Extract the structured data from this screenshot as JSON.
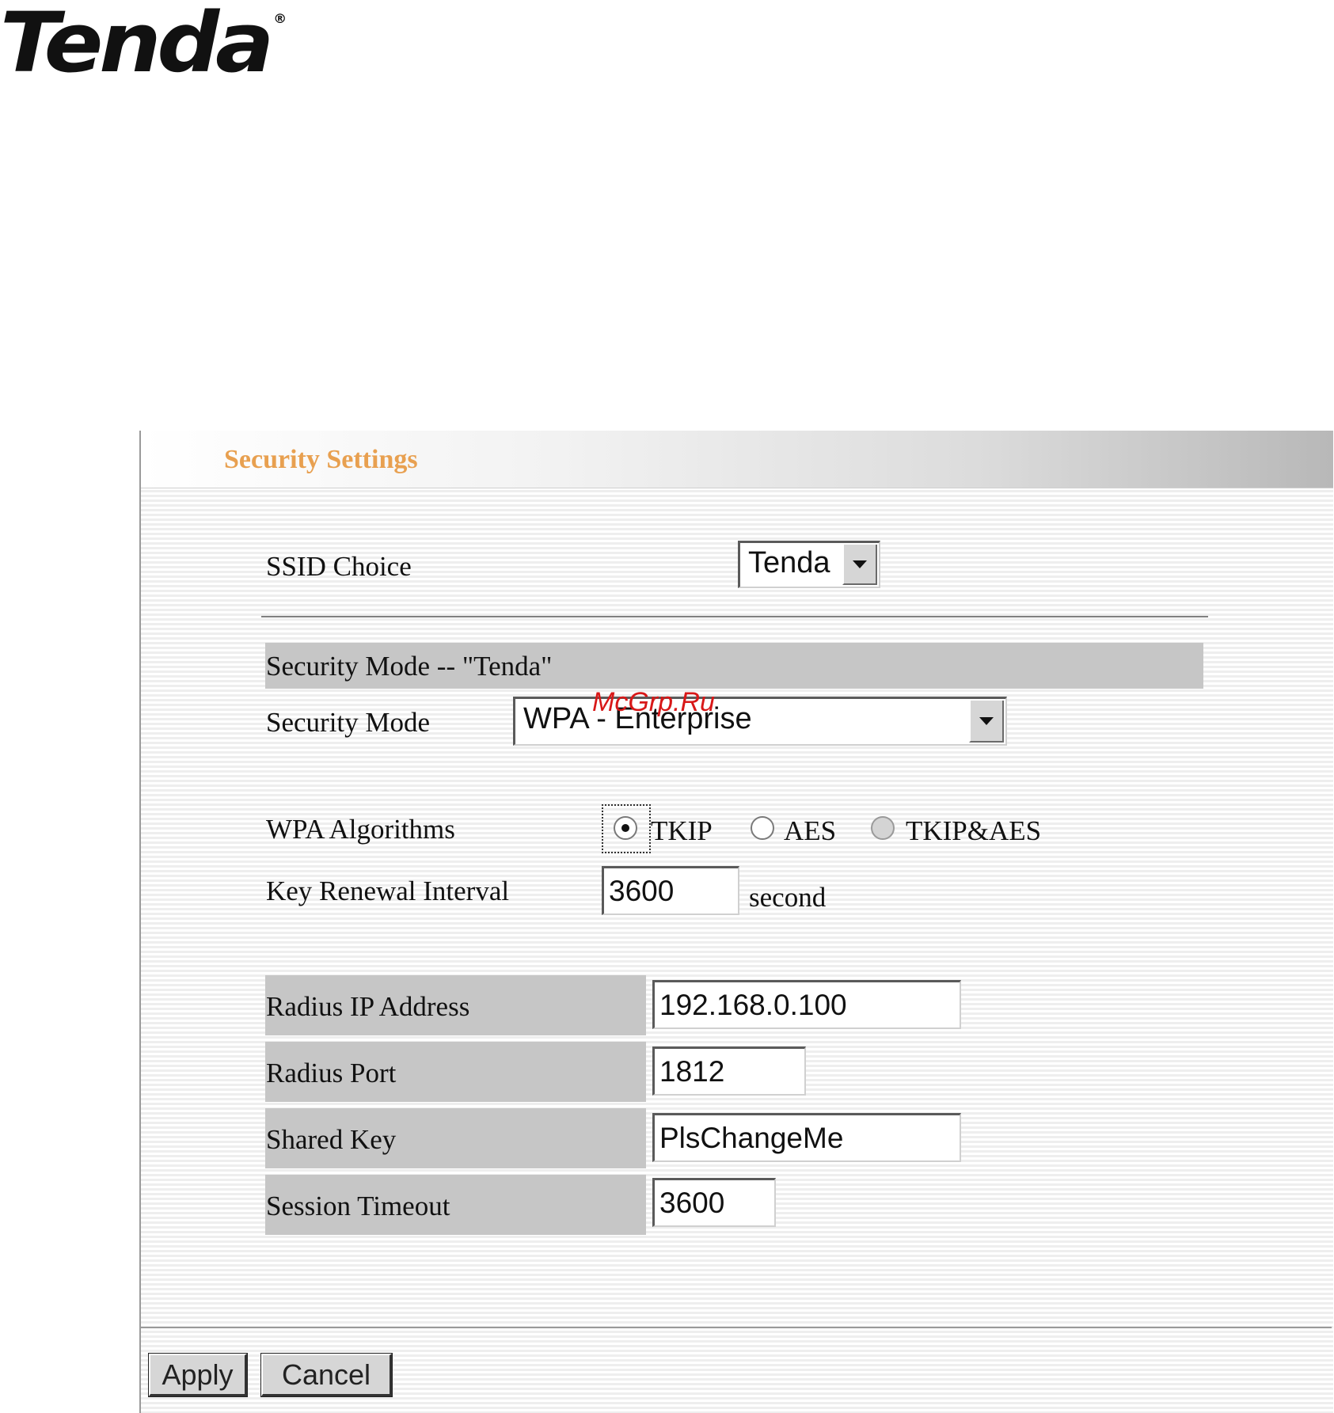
{
  "brand": {
    "logo_text": "Tenda",
    "registered_mark": "®"
  },
  "panel": {
    "title": "Security Settings"
  },
  "ssid": {
    "label": "SSID Choice",
    "selected": "Tenda"
  },
  "security_mode": {
    "section_title": "Security Mode -- \"Tenda\"",
    "label": "Security Mode",
    "selected": "WPA - Enterprise"
  },
  "wpa_algorithms": {
    "label": "WPA Algorithms",
    "options": [
      {
        "label": "TKIP",
        "checked": true
      },
      {
        "label": "AES",
        "checked": false
      },
      {
        "label": "TKIP&AES",
        "checked": false,
        "disabled": true
      }
    ]
  },
  "key_renewal": {
    "label": "Key Renewal Interval",
    "value": "3600",
    "unit": "second"
  },
  "radius": {
    "ip_label": "Radius IP Address",
    "ip_value": "192.168.0.100",
    "port_label": "Radius Port",
    "port_value": "1812",
    "shared_key_label": "Shared Key",
    "shared_key_value": "PlsChangeMe",
    "session_timeout_label": "Session Timeout",
    "session_timeout_value": "3600"
  },
  "buttons": {
    "apply": "Apply",
    "cancel": "Cancel"
  },
  "watermark": "McGrp.Ru",
  "colors": {
    "title": "#e8a050",
    "section_bg": "#c6c6c6",
    "watermark": "#d81818"
  }
}
